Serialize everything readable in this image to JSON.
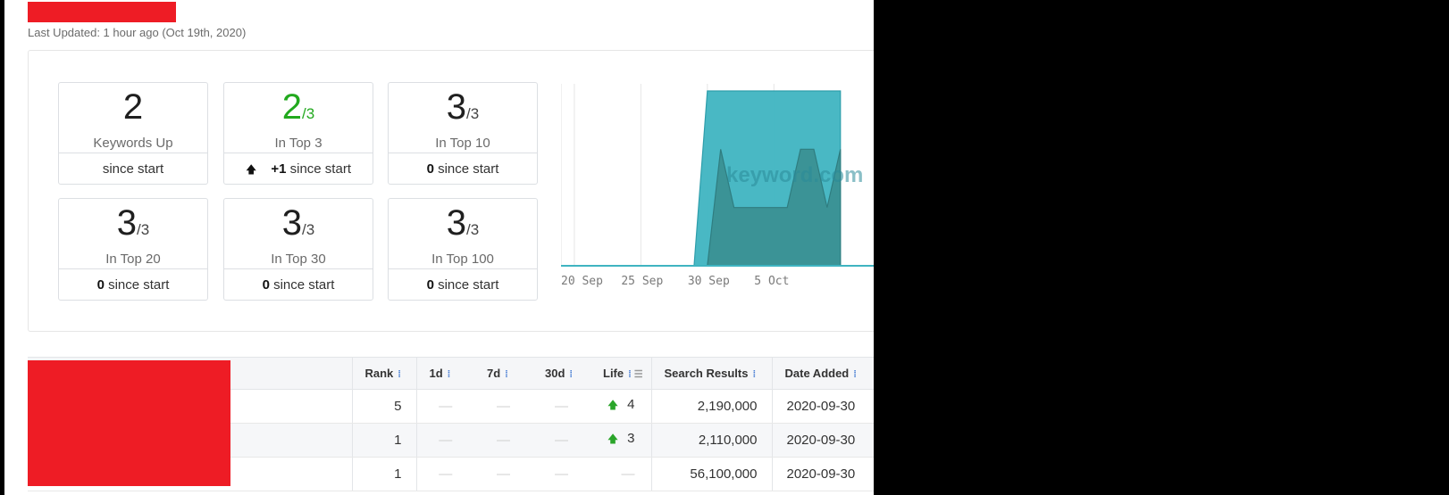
{
  "header": {
    "last_updated": "Last Updated: 1 hour ago (Oct 19th, 2020)"
  },
  "stats": [
    {
      "value": "2",
      "denominator": "",
      "label": "Keywords Up",
      "change": "",
      "change_suffix": "since start",
      "highlight": false
    },
    {
      "value": "2",
      "denominator": "/3",
      "label": "In Top 3",
      "change": "+1",
      "change_suffix": "since start",
      "highlight": true,
      "change_icon": "arrow-up-icon"
    },
    {
      "value": "3",
      "denominator": "/3",
      "label": "In Top 10",
      "change": "0",
      "change_suffix": "since start",
      "highlight": false
    },
    {
      "value": "3",
      "denominator": "/3",
      "label": "In Top 20",
      "change": "0",
      "change_suffix": "since start",
      "highlight": false
    },
    {
      "value": "3",
      "denominator": "/3",
      "label": "In Top 30",
      "change": "0",
      "change_suffix": "since start",
      "highlight": false
    },
    {
      "value": "3",
      "denominator": "/3",
      "label": "In Top 100",
      "change": "0",
      "change_suffix": "since start",
      "highlight": false
    }
  ],
  "chart_data": {
    "type": "area",
    "x_ticks": [
      "20 Sep",
      "25 Sep",
      "30 Sep",
      "5 Oct"
    ],
    "watermark": "keyword.com",
    "x": [
      "2020-09-19",
      "2020-09-29",
      "2020-09-30",
      "2020-10-01",
      "2020-10-02",
      "2020-10-06",
      "2020-10-07",
      "2020-10-08",
      "2020-10-09",
      "2020-10-10"
    ],
    "series": [
      {
        "values": [
          0,
          0,
          3,
          3,
          3,
          3,
          3,
          3,
          3,
          3
        ],
        "color": "#3fb4c1"
      },
      {
        "values": [
          0,
          0,
          0,
          2,
          1,
          1,
          2,
          2,
          1,
          2
        ],
        "color": "#3a8f91"
      }
    ],
    "ylim": [
      0,
      3
    ]
  },
  "table": {
    "columns": [
      "Rank",
      "1d",
      "7d",
      "30d",
      "Life",
      "Search Results",
      "Date Added"
    ],
    "rows": [
      {
        "rank": "5",
        "d1": "—",
        "d7": "—",
        "d30": "—",
        "life": "4",
        "life_up": true,
        "search_results": "2,190,000",
        "date_added": "2020-09-30"
      },
      {
        "rank": "1",
        "d1": "—",
        "d7": "—",
        "d30": "—",
        "life": "3",
        "life_up": true,
        "search_results": "2,110,000",
        "date_added": "2020-09-30"
      },
      {
        "rank": "1",
        "d1": "—",
        "d7": "—",
        "d30": "—",
        "life": "—",
        "life_up": false,
        "search_results": "56,100,000",
        "date_added": "2020-09-30"
      }
    ]
  },
  "colors": {
    "redaction": "#ee1c25",
    "green": "#22a91e",
    "sort_icon": "#4a7fd4"
  }
}
